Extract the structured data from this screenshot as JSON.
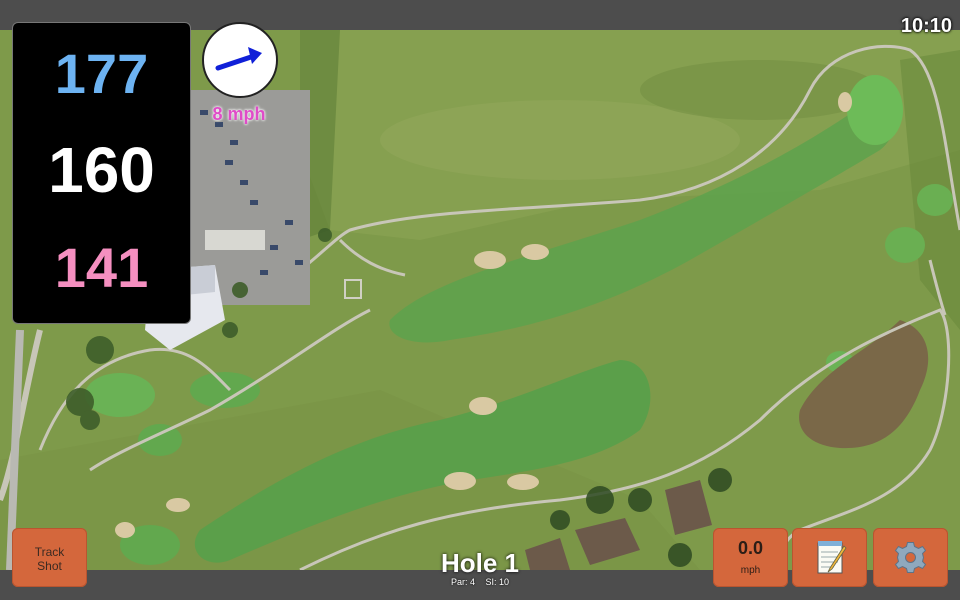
{
  "status": {
    "clock": "10:10"
  },
  "distances": {
    "back": "177",
    "middle": "160",
    "front": "141"
  },
  "wind": {
    "speed": "8 mph",
    "icon": "wind-arrow-icon"
  },
  "hole": {
    "title": "Hole 1",
    "par": "Par: 4",
    "si": "SI: 10"
  },
  "buttons": {
    "track_line1": "Track",
    "track_line2": "Shot",
    "speed_value": "0.0",
    "speed_unit": "mph",
    "notes_icon": "notepad-icon",
    "settings_icon": "gear-icon"
  },
  "colors": {
    "back_distance": "#6db3f2",
    "middle_distance": "#ffffff",
    "front_distance": "#f58fc0",
    "wind_text": "#e04cc8",
    "button": "#d4673c"
  }
}
